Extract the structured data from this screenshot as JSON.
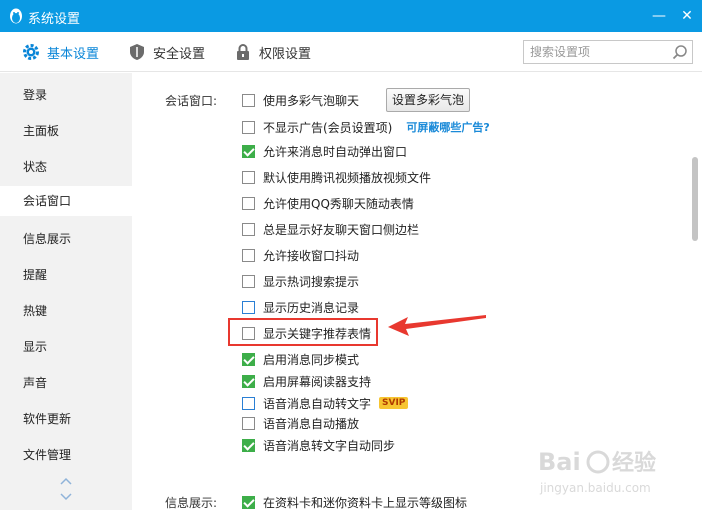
{
  "window": {
    "title": "系统设置",
    "minimize": "—",
    "close": "✕"
  },
  "tabs": [
    {
      "label": "基本设置",
      "icon": "gear-icon",
      "active": true
    },
    {
      "label": "安全设置",
      "icon": "shield-icon",
      "active": false
    },
    {
      "label": "权限设置",
      "icon": "lock-icon",
      "active": false
    }
  ],
  "search": {
    "placeholder": "搜索设置项",
    "icon": "search-icon"
  },
  "sidebar": {
    "items": [
      {
        "label": "登录"
      },
      {
        "label": "主面板"
      },
      {
        "label": "状态"
      },
      {
        "label": "会话窗口",
        "active": true
      },
      {
        "label": "信息展示"
      },
      {
        "label": "提醒"
      },
      {
        "label": "热键"
      },
      {
        "label": "显示"
      },
      {
        "label": "声音"
      },
      {
        "label": "软件更新"
      },
      {
        "label": "文件管理"
      }
    ]
  },
  "session_window": {
    "section_label": "会话窗口:",
    "bubble_button": "设置多彩气泡",
    "ad_link": "可屏蔽哪些广告?",
    "vip_badge": "SVIP",
    "options": [
      {
        "label": "使用多彩气泡聊天",
        "checked": false
      },
      {
        "label": "不显示广告(会员设置项)",
        "checked": false
      },
      {
        "label": "允许来消息时自动弹出窗口",
        "checked": true
      },
      {
        "label": "默认使用腾讯视频播放视频文件",
        "checked": false
      },
      {
        "label": "允许使用QQ秀聊天随动表情",
        "checked": false
      },
      {
        "label": "总是显示好友聊天窗口侧边栏",
        "checked": false
      },
      {
        "label": "允许接收窗口抖动",
        "checked": false
      },
      {
        "label": "显示热词搜索提示",
        "checked": false
      },
      {
        "label": "显示历史消息记录",
        "checked": false
      },
      {
        "label": "显示关键字推荐表情",
        "checked": false
      },
      {
        "label": "启用消息同步模式",
        "checked": true
      },
      {
        "label": "启用屏幕阅读器支持",
        "checked": true
      },
      {
        "label": "语音消息自动转文字",
        "checked": false
      },
      {
        "label": "语音消息自动播放",
        "checked": false
      },
      {
        "label": "语音消息转文字自动同步",
        "checked": true
      }
    ]
  },
  "info_display": {
    "section_label": "信息展示:",
    "options": [
      {
        "label": "在资料卡和迷你资料卡上显示等级图标",
        "checked": true
      }
    ]
  },
  "colors": {
    "titlebar": "#0a9ae3",
    "accent": "#0a86d8",
    "check": "#3dae49",
    "annotation": "#e8382f"
  },
  "watermark": {
    "brand": "Baidu经验",
    "url": "jingyan.baidu.com"
  }
}
